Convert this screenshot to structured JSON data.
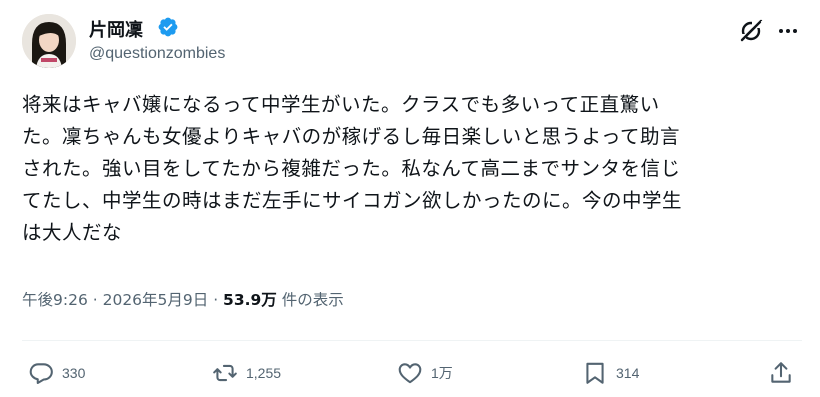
{
  "author": {
    "display_name": "片岡凜",
    "handle": "@questionzombies"
  },
  "post": {
    "lines": [
      "将来はキャバ嬢になるって中学生がいた。クラスでも多いって正直驚い",
      "た。凜ちゃんも女優よりキャバのが稼げるし毎日楽しいと思うよって助言",
      "された。強い目をしてたから複雑だった。私なんて高二までサンタを信じ",
      "てたし、中学生の時はまだ左手にサイコガン欲しかったのに。今の中学生",
      "は大人だな"
    ]
  },
  "meta": {
    "time": "午後9:26",
    "separator1": " · ",
    "date": "2026年5月9日",
    "separator2": " · ",
    "views_count": "53.9万",
    "views_label": " 件の表示"
  },
  "actions": {
    "replies": "330",
    "reposts": "1,255",
    "likes": "1万",
    "bookmarks": "314"
  },
  "colors": {
    "verified": "#1d9bf0",
    "muted": "#536471",
    "text": "#0f1419"
  }
}
